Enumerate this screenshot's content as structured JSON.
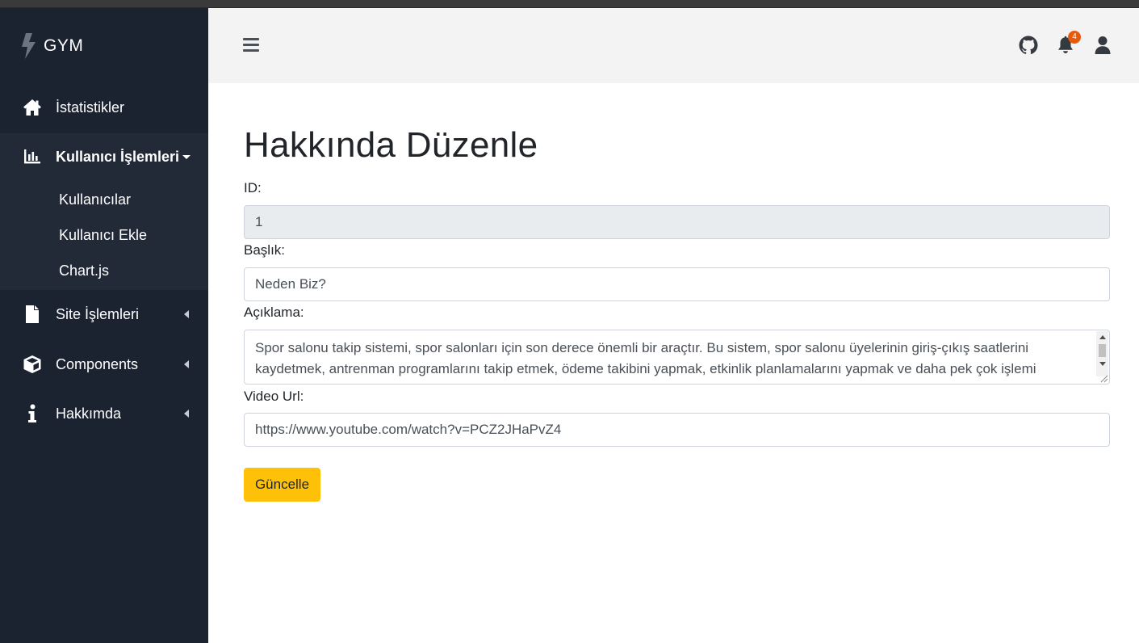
{
  "brand": {
    "name": "GYM",
    "icon": "bolt-icon"
  },
  "sidebar": {
    "items": [
      {
        "label": "İstatistikler",
        "icon": "home-icon"
      },
      {
        "label": "Kullanıcı İşlemleri",
        "icon": "chart-bar-icon",
        "expanded": true,
        "children": [
          {
            "label": "Kullanıcılar"
          },
          {
            "label": "Kullanıcı Ekle"
          },
          {
            "label": "Chart.js"
          }
        ]
      },
      {
        "label": "Site İşlemleri",
        "icon": "file-icon"
      },
      {
        "label": "Components",
        "icon": "cube-icon"
      },
      {
        "label": "Hakkımda",
        "icon": "info-icon"
      }
    ]
  },
  "topbar": {
    "menu_icon": "hamburger-icon",
    "github_icon": "github-icon",
    "notifications": {
      "icon": "bell-icon",
      "count": "4"
    },
    "user_icon": "user-icon"
  },
  "page": {
    "title": "Hakkında Düzenle",
    "form": {
      "id_label": "ID:",
      "id_value": "1",
      "title_label": "Başlık:",
      "title_value": "Neden Biz?",
      "desc_label": "Açıklama:",
      "desc_value": "Spor salonu takip sistemi, spor salonları için son derece önemli bir araçtır. Bu sistem, spor salonu üyelerinin giriş-çıkış saatlerini kaydetmek, antrenman programlarını takip etmek, ödeme takibini yapmak, etkinlik planlamalarını yapmak ve daha pek çok işlemi",
      "video_label": "Video Url:",
      "video_value": "https://www.youtube.com/watch?v=PCZ2JHaPvZ4",
      "submit_label": "Güncelle"
    }
  },
  "colors": {
    "sidebar_bg": "#1b2230",
    "submenu_bg": "#222a38",
    "topbar_bg": "#f3f3f3",
    "button_bg": "#ffc107",
    "badge_bg": "#e8590c"
  }
}
